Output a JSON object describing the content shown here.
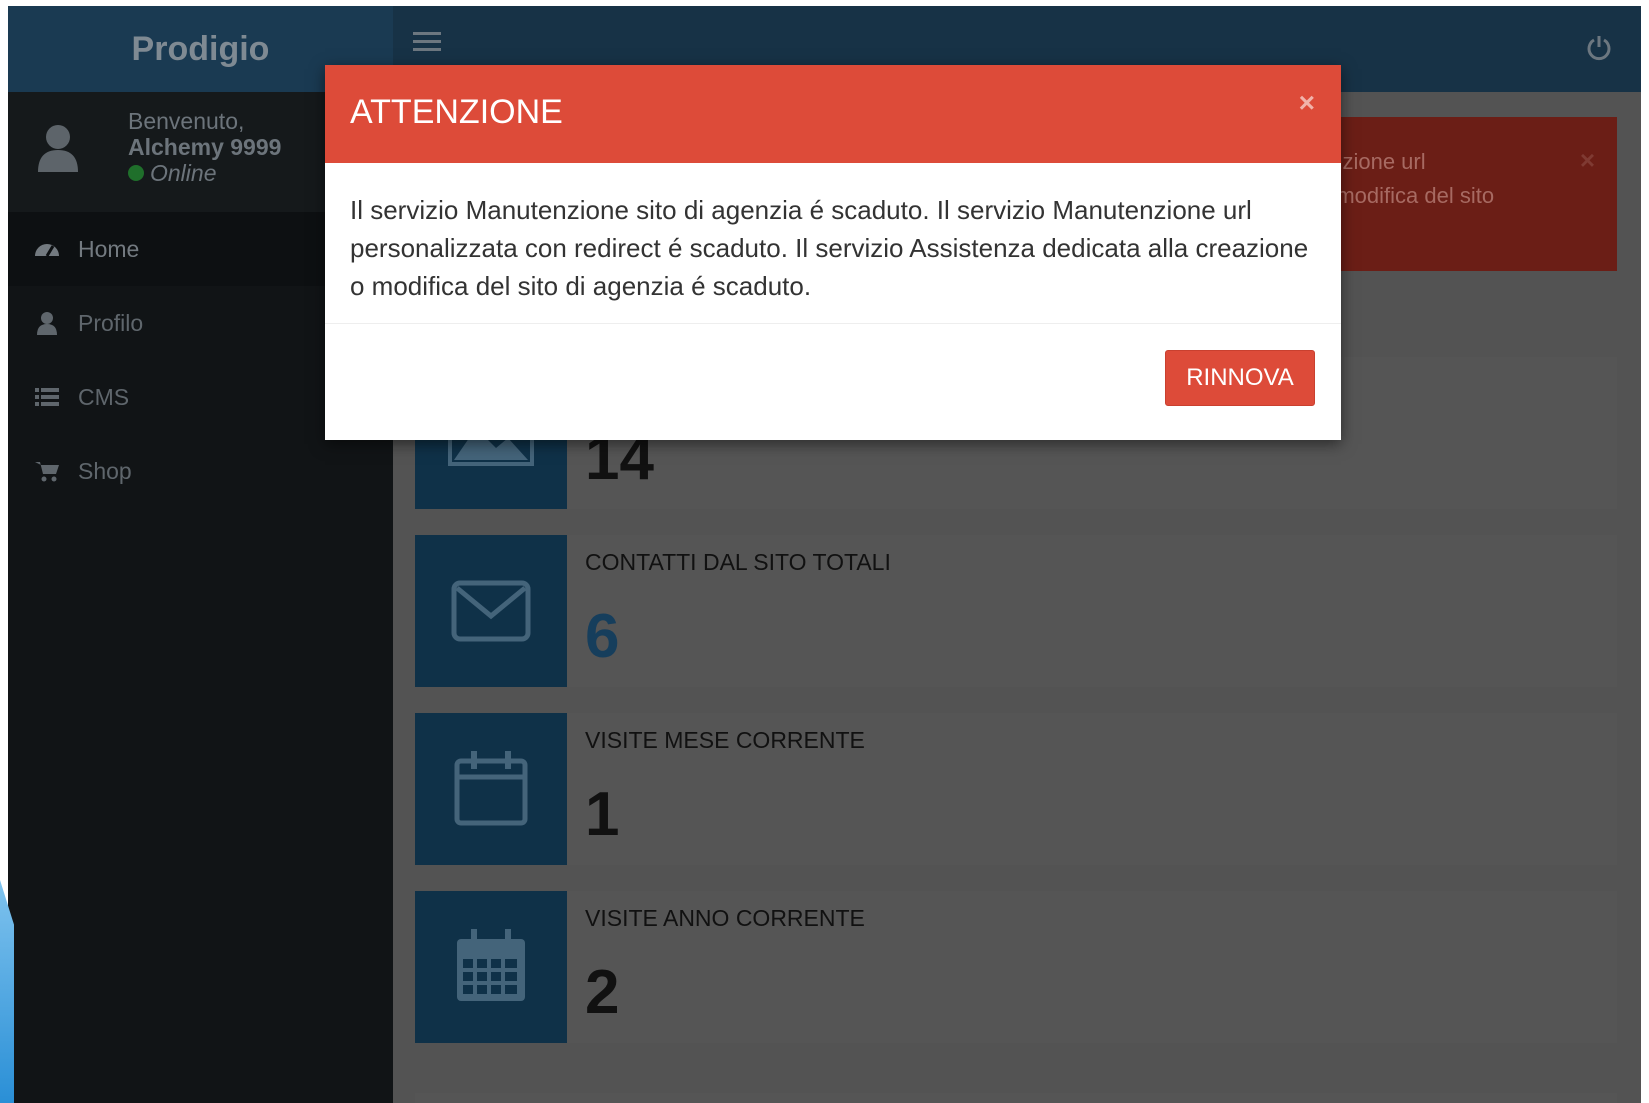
{
  "brand": "Prodigio",
  "user": {
    "greeting": "Benvenuto,",
    "name": "Alchemy 9999",
    "status": "Online"
  },
  "menu": [
    {
      "label": "Home",
      "icon": "dashboard-icon"
    },
    {
      "label": "Profilo",
      "icon": "user-icon"
    },
    {
      "label": "CMS",
      "icon": "list-icon"
    },
    {
      "label": "Shop",
      "icon": "cart-icon"
    }
  ],
  "alert": {
    "line1": "enzione url",
    "line2": "o modifica del sito",
    "close": "×"
  },
  "stats": [
    {
      "label": "",
      "value": "14",
      "icon": "image-icon"
    },
    {
      "label": "CONTATTI DAL SITO TOTALI",
      "value": "6",
      "icon": "envelope-icon"
    },
    {
      "label": "VISITE MESE CORRENTE",
      "value": "1",
      "icon": "calendar-icon"
    },
    {
      "label": "VISITE ANNO CORRENTE",
      "value": "2",
      "icon": "calendar-grid-icon"
    }
  ],
  "modal": {
    "title": "ATTENZIONE",
    "close": "×",
    "message": "Il servizio Manutenzione sito di agenzia é scaduto. Il servizio Manutenzione url personalizzata con redirect é scaduto. Il servizio Assistenza dedicata alla creazione o modifica del sito di agenzia é scaduto.",
    "button": "RINNOVA"
  },
  "colors": {
    "modal_header": "#dd4b39",
    "button": "#dd4b39",
    "stat_icon_bg": "#0f3148",
    "header": "#173246"
  }
}
